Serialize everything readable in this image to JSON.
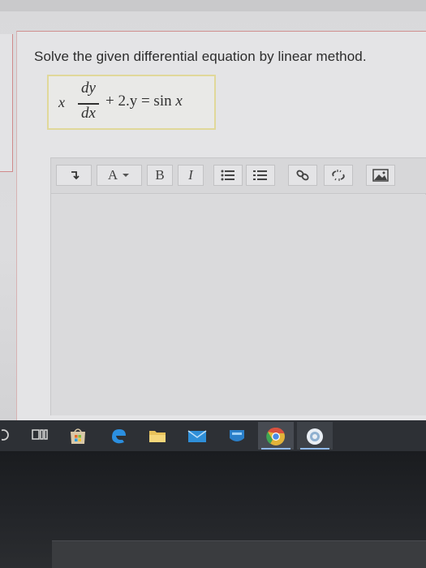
{
  "question": {
    "prompt": "Solve the given differential equation by linear method."
  },
  "equation": {
    "coefficient": "x",
    "numerator": "dy",
    "denominator": "dx",
    "rest_plain": "+ 2.y = sin",
    "rest_var": " x"
  },
  "toolbar": {
    "font_menu_label": "A",
    "bold_label": "B",
    "italic_label": "I"
  },
  "colors": {
    "highlight_border": "#e0d89a",
    "panel_border": "#cf8f8f",
    "taskbar": "#2d3035"
  },
  "icons": [
    "paragraph-icon",
    "font-color-icon",
    "bold-icon",
    "italic-icon",
    "bullet-list-icon",
    "numbered-list-icon",
    "link-icon",
    "unlink-icon",
    "image-icon",
    "search-icon",
    "task-view-icon",
    "store-icon",
    "edge-icon",
    "file-explorer-icon",
    "mail-icon",
    "app-icon",
    "chrome-icon",
    "ie-icon"
  ]
}
